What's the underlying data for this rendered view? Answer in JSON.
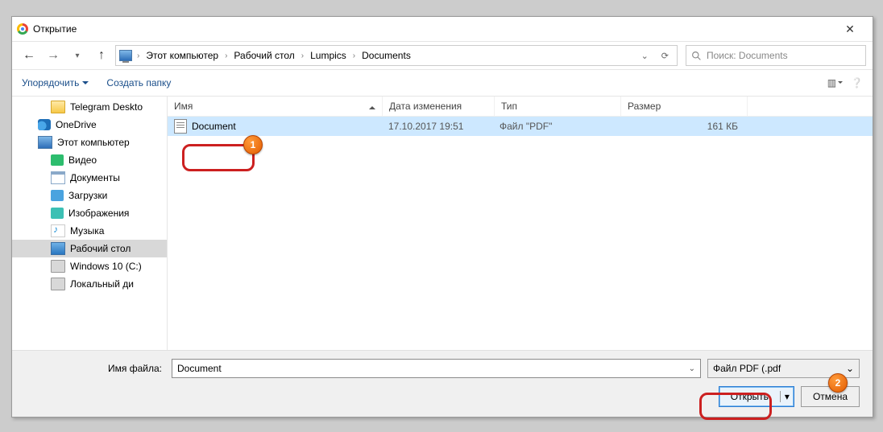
{
  "window": {
    "title": "Открытие"
  },
  "breadcrumbs": [
    "Этот компьютер",
    "Рабочий стол",
    "Lumpics",
    "Documents"
  ],
  "search": {
    "placeholder": "Поиск: Documents"
  },
  "toolbar": {
    "organize": "Упорядочить",
    "newfolder": "Создать папку"
  },
  "viewbtn": {
    "glyph": "▥"
  },
  "help": {
    "glyph": "❔"
  },
  "columns": {
    "name": "Имя",
    "date": "Дата изменения",
    "type": "Тип",
    "size": "Размер"
  },
  "sidebar": {
    "items": [
      {
        "label": "Telegram Deskto",
        "icon": "folder",
        "lvl": 1
      },
      {
        "label": "OneDrive",
        "icon": "onedrive",
        "lvl": 0
      },
      {
        "label": "Этот компьютер",
        "icon": "pc",
        "lvl": 0
      },
      {
        "label": "Видео",
        "icon": "video",
        "lvl": 1
      },
      {
        "label": "Документы",
        "icon": "doc",
        "lvl": 1
      },
      {
        "label": "Загрузки",
        "icon": "dl",
        "lvl": 1
      },
      {
        "label": "Изображения",
        "icon": "img",
        "lvl": 1
      },
      {
        "label": "Музыка",
        "icon": "music",
        "lvl": 1
      },
      {
        "label": "Рабочий стол",
        "icon": "desktop",
        "lvl": 1,
        "sel": true
      },
      {
        "label": "Windows 10 (C:)",
        "icon": "drive",
        "lvl": 1
      },
      {
        "label": "Локальный ди",
        "icon": "drive",
        "lvl": 1
      }
    ]
  },
  "files": [
    {
      "name": "Document",
      "date": "17.10.2017 19:51",
      "type": "Файл \"PDF\"",
      "size": "161 КБ",
      "sel": true
    }
  ],
  "footer": {
    "filelabel": "Имя файла:",
    "filename": "Document",
    "filter": "Файл PDF (.pdf",
    "open": "Открыть",
    "cancel": "Отмена"
  },
  "badges": {
    "one": "1",
    "two": "2"
  }
}
